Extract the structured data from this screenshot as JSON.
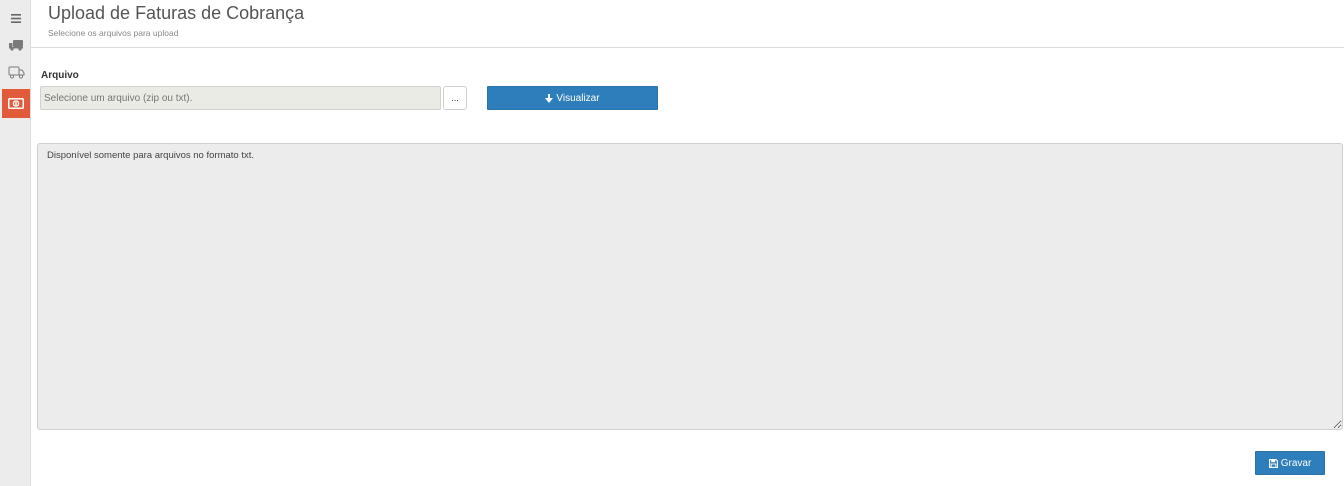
{
  "sidebar": {
    "items": [
      {
        "icon": "menu-icon"
      },
      {
        "icon": "truck-icon"
      },
      {
        "icon": "truck-outline-icon"
      },
      {
        "icon": "money-icon",
        "active": true
      }
    ],
    "active_color": "#e15a3a"
  },
  "header": {
    "title": "Upload de Faturas de Cobrança",
    "subtitle": "Selecione os arquivos para upload"
  },
  "form": {
    "file_label": "Arquivo",
    "file_placeholder": "Selecione um arquivo (zip ou txt).",
    "browse_label": "...",
    "view_label": "Visualizar",
    "view_icon": "arrow-down-icon",
    "info_text": "Disponível somente para arquivos no formato txt."
  },
  "footer": {
    "save_label": "Gravar",
    "save_icon": "floppy-icon"
  },
  "colors": {
    "primary": "#2f7ebc",
    "accent": "#e15a3a"
  }
}
